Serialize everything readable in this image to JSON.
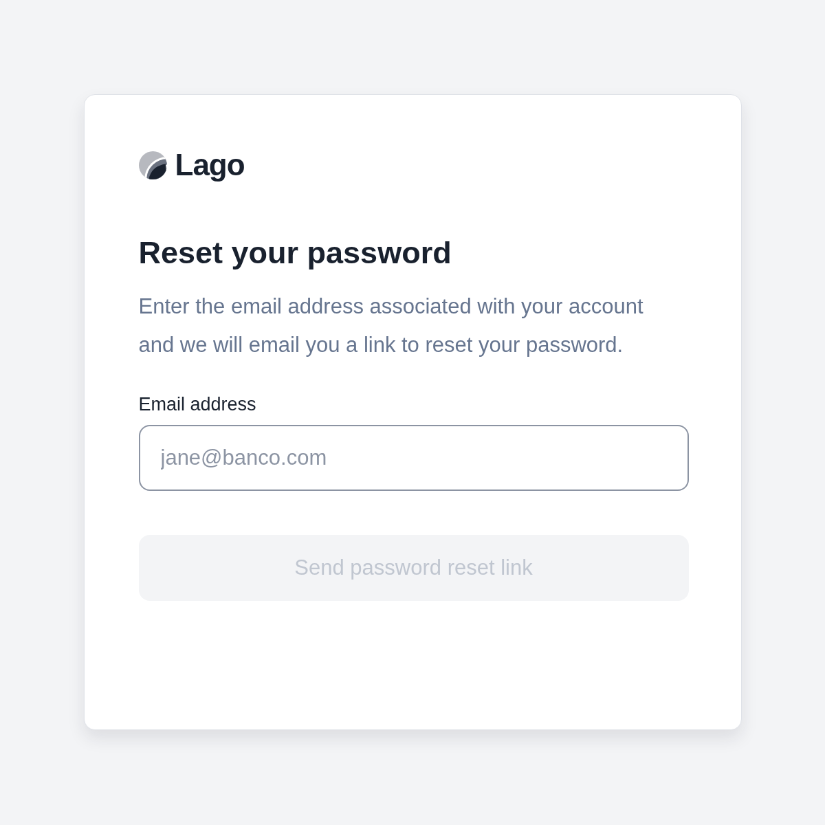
{
  "logo": {
    "text": "Lago"
  },
  "title": "Reset your password",
  "description": "Enter the email address associated with your account and we will email you a link to reset your password.",
  "email_field": {
    "label": "Email address",
    "placeholder": "jane@banco.com"
  },
  "submit_button": {
    "label": "Send password reset link",
    "disabled": true
  }
}
